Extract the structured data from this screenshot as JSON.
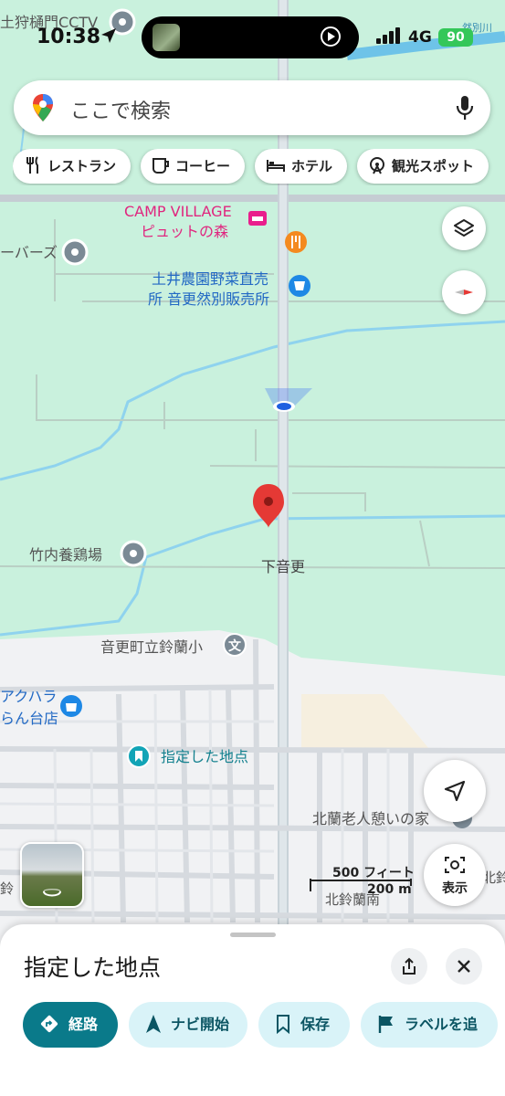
{
  "status_bar": {
    "time": "10:38",
    "network": "4G",
    "battery": "90"
  },
  "search": {
    "placeholder": "ここで検索",
    "icons": [
      "maps-pin-logo",
      "mic-icon"
    ]
  },
  "chips": [
    {
      "label": "レストラン",
      "icon": "fork-knife-icon"
    },
    {
      "label": "コーヒー",
      "icon": "coffee-cup-icon"
    },
    {
      "label": "ホテル",
      "icon": "bed-icon"
    },
    {
      "label": "観光スポット",
      "icon": "ferris-wheel-icon"
    }
  ],
  "map_labels": {
    "cctv": "土狩樋門CCTV",
    "river": "然別川",
    "burgers": "ーバーズ",
    "camp1": "CAMP VILLAGE",
    "camp2": "ピュットの森",
    "farm1": "土井農園野菜直売",
    "farm2": "所 音更然別販売所",
    "poultry": "竹内養鶏場",
    "district": "下音更",
    "school": "音更町立鈴蘭小",
    "shop1": "アクハラ",
    "shop2": "らん台店",
    "pinned": "指定した地点",
    "elderly": "北蘭老人憩いの家",
    "north_suzuran": "北鈴蘭南",
    "kita": "北鈴",
    "suzu": "鈴"
  },
  "scale": {
    "feet": "500 フィート",
    "meters": "200 m"
  },
  "controls": {
    "show_label": "表示"
  },
  "sheet": {
    "title": "指定した地点",
    "actions": [
      {
        "label": "経路",
        "icon": "directions-icon",
        "primary": true
      },
      {
        "label": "ナビ開始",
        "icon": "navigation-arrow-icon"
      },
      {
        "label": "保存",
        "icon": "bookmark-icon"
      },
      {
        "label": "ラベルを追",
        "icon": "flag-icon"
      }
    ]
  },
  "colors": {
    "map_green": "#c8f0dc",
    "urban": "#f1f2f4",
    "water": "#8fd3ee",
    "accent": "#0a7a8a",
    "pin_red": "#e53935"
  }
}
